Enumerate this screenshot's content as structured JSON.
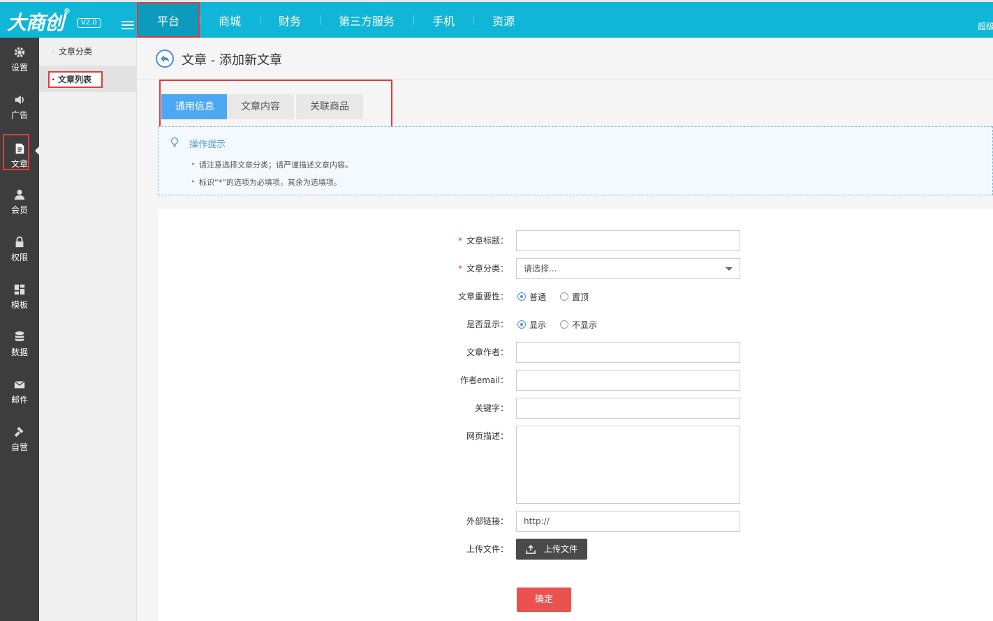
{
  "brand": {
    "logo": "大商创",
    "trademark": "®",
    "version": "V2.0"
  },
  "topnav": [
    "平台",
    "商城",
    "财务",
    "第三方服务",
    "手机",
    "资源"
  ],
  "user_label": "超级管理员",
  "sidebar": [
    {
      "label": "设置",
      "icon": "gear-icon"
    },
    {
      "label": "广告",
      "icon": "speaker-icon"
    },
    {
      "label": "文章",
      "icon": "document-icon"
    },
    {
      "label": "会员",
      "icon": "user-icon"
    },
    {
      "label": "权限",
      "icon": "lock-icon"
    },
    {
      "label": "模板",
      "icon": "grid-icon"
    },
    {
      "label": "数据",
      "icon": "database-icon"
    },
    {
      "label": "邮件",
      "icon": "mail-icon"
    },
    {
      "label": "自营",
      "icon": "hammer-icon"
    }
  ],
  "submenu": [
    "文章分类",
    "文章列表"
  ],
  "page_title": "文章 - 添加新文章",
  "tabs": [
    "通用信息",
    "文章内容",
    "关联商品"
  ],
  "tips": {
    "title": "操作提示",
    "lines": [
      "请注意选择文章分类；请严谨描述文章内容。",
      "标识“*”的选项为必填项，其余为选填项。"
    ]
  },
  "form": {
    "title_label": "文章标题：",
    "category_label": "文章分类：",
    "category_value": "请选择...",
    "importance_label": "文章重要性：",
    "importance_options": [
      "普通",
      "置顶"
    ],
    "display_label": "是否显示：",
    "display_options": [
      "显示",
      "不显示"
    ],
    "author_label": "文章作者：",
    "email_label": "作者email：",
    "keywords_label": "关键字：",
    "description_label": "网页描述：",
    "link_label": "外部链接：",
    "link_value": "http://",
    "upload_label": "上传文件：",
    "upload_button": "上传文件",
    "submit": "确定"
  }
}
